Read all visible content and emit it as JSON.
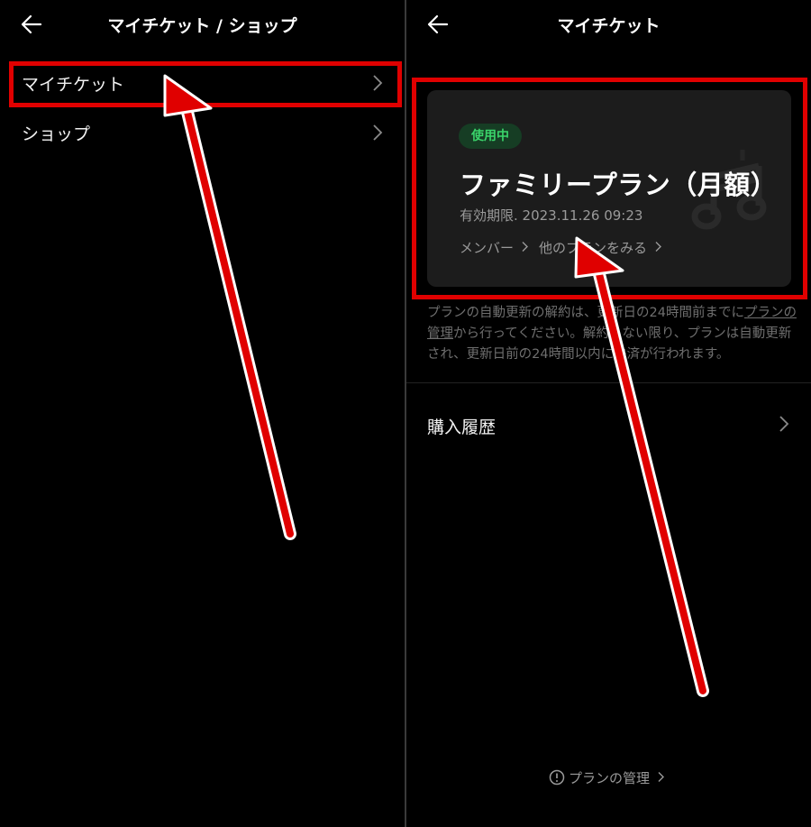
{
  "left": {
    "title": "マイチケット / ショップ",
    "items": [
      {
        "label": "マイチケット"
      },
      {
        "label": "ショップ"
      }
    ]
  },
  "right": {
    "title": "マイチケット",
    "card": {
      "badge": "使用中",
      "plan_name": "ファミリープラン（月額）",
      "expiry": "有効期限. 2023.11.26 09:23",
      "members_link": "メンバー",
      "other_plans_link": "他のプランをみる"
    },
    "note_line1_pre": "プランの自動更新の解約は、更新日の24時間前までに",
    "note_link": "プランの管理",
    "note_rest": "から行ってください。解約しない限り、プランは自動更新され、更新日前の24時間以内に決済が行われます。",
    "history_label": "購入履歴",
    "manage_label": "プランの管理"
  },
  "colors": {
    "background": "#000000",
    "card": "#1c1c1c",
    "badge_text": "#3ad36a",
    "highlight": "#e00000"
  },
  "icons": [
    "back-arrow-icon",
    "chevron-right-icon",
    "music-note-icon",
    "info-circle-icon"
  ]
}
